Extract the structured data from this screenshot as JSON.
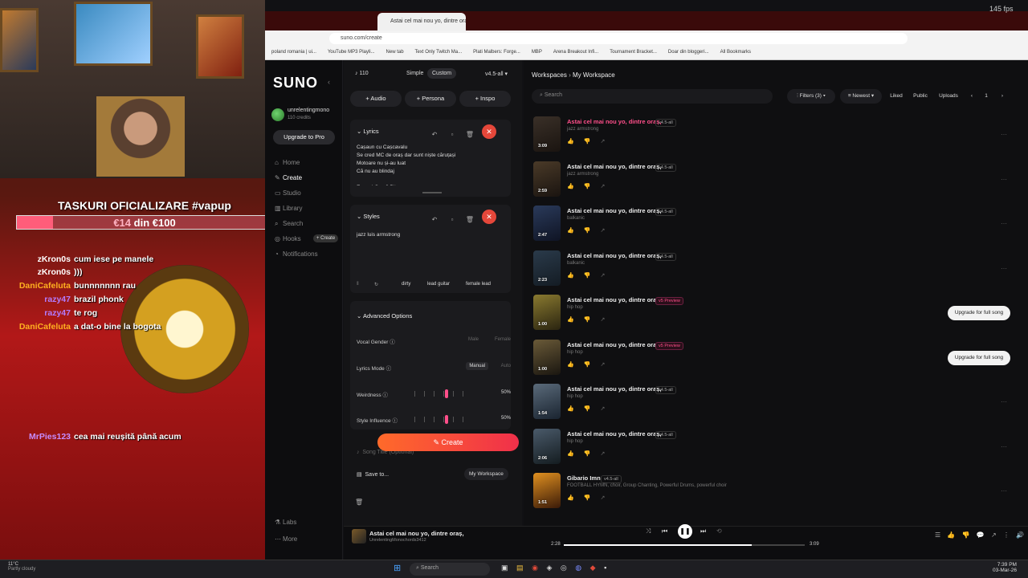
{
  "stream": {
    "task_title": "TASKURI OFICIALIZARE #vapup",
    "goal_current": "€14",
    "goal_text": " din €100",
    "goal_fraction": 0.14,
    "chat": [
      {
        "user": "zKron0s",
        "message": "cum iese pe manele",
        "color": "#ffffff"
      },
      {
        "user": "zKron0s",
        "message": ")))",
        "color": "#ffffff"
      },
      {
        "user": "DaniCafeluta",
        "message": "bunnnnnnn rau",
        "color": "#ffb020"
      },
      {
        "user": "razy47",
        "message": "brazil phonk",
        "color": "#b37cff"
      },
      {
        "user": "razy47",
        "message": "te rog",
        "color": "#b37cff"
      },
      {
        "user": "DaniCafeluta",
        "message": "a dat-o bine la bogota",
        "color": "#ffb020"
      },
      {
        "user": "MrPies123",
        "message": "cea mai reușită până acum",
        "color": "#c68cff"
      }
    ]
  },
  "fps": "145 fps",
  "browser": {
    "tab_title": "Astai cel mai nou yo, dintre oraș",
    "url": "suno.com/create",
    "bookmarks": [
      "poland romania | ui...",
      "YouTube MP3 Playli...",
      "New tab",
      "Text Only Twitch Ma...",
      "Plati Malbers: Forge...",
      "MBP",
      "Arena Breakout Infi...",
      "Tournament Bracket...",
      "Doar din bloggeri...",
      "All Bookmarks"
    ]
  },
  "nav": {
    "logo": "SUNO",
    "user_name": "unrelentingmono",
    "user_credits": "110 credits",
    "upgrade": "Upgrade to Pro",
    "items": [
      {
        "label": "Home",
        "icon": "⌂"
      },
      {
        "label": "Create",
        "icon": "✎"
      },
      {
        "label": "Studio",
        "icon": "▭"
      },
      {
        "label": "Library",
        "icon": "▥"
      },
      {
        "label": "Search",
        "icon": "⌕"
      },
      {
        "label": "Hooks",
        "icon": "◎"
      },
      {
        "label": "Notifications",
        "icon": "◔"
      }
    ],
    "hooks_badge": "+ Create",
    "bottom": [
      {
        "label": "Labs",
        "icon": "⚗"
      },
      {
        "label": "More",
        "icon": "⋯"
      }
    ]
  },
  "create": {
    "credits": "110",
    "mode_simple": "Simple",
    "mode_custom": "Custom",
    "model": "v4.5-all",
    "add_buttons": [
      "+ Audio",
      "+ Persona",
      "+ Inspo"
    ],
    "lyrics_title": "Lyrics",
    "lyrics_lines": [
      "Cașaun cu Cașcavalu",
      "Se cred MC de oraș dar sunt niște căruțași",
      "Motoare nu și-au luat",
      "Că nu au blindaj",
      "",
      "E ușor! Ceață Pitpaua"
    ],
    "styles_title": "Styles",
    "styles_text": "jazz luis armstrong",
    "style_tags": [
      "dirty",
      "lead guitar",
      "female lead"
    ],
    "advanced_title": "Advanced Options",
    "vocal_gender": {
      "label": "Vocal Gender",
      "opt1": "Male",
      "opt2": "Female"
    },
    "lyrics_mode": {
      "label": "Lyrics Mode",
      "opt1": "Manual",
      "opt2": "Auto"
    },
    "weirdness": {
      "label": "Weirdness",
      "value": "50%"
    },
    "style_influence": {
      "label": "Style Influence",
      "value": "50%"
    },
    "song_title_placeholder": "Song Title (Optional)",
    "save_to": "Save to...",
    "workspace": "My Workspace",
    "create_button": "Create"
  },
  "workspace": {
    "crumb_root": "Workspaces",
    "crumb_current": "My Workspace",
    "search_placeholder": "Search",
    "filters": "Filters (3)",
    "sort": "Newest",
    "liked": "Liked",
    "public": "Public",
    "uploads": "Uploads",
    "page": "1",
    "songs": [
      {
        "title": "Astai cel mai nou yo, dintre oraș,",
        "version": "v4.5-all",
        "style": "jazz armstrong",
        "duration": "3:09",
        "preview": false,
        "upgrade": false,
        "highlight": true,
        "colors": [
          "#3a3028",
          "#1a1410"
        ]
      },
      {
        "title": "Astai cel mai nou yo, dintre oraș,",
        "version": "v4.5-all",
        "style": "jazz armstrong",
        "duration": "2:59",
        "preview": false,
        "upgrade": false,
        "highlight": false,
        "colors": [
          "#4a3a28",
          "#1a1410"
        ]
      },
      {
        "title": "Astai cel mai nou yo, dintre oraș,",
        "version": "v4.5-all",
        "style": "balkanic",
        "duration": "2:47",
        "preview": false,
        "upgrade": false,
        "highlight": false,
        "colors": [
          "#2a3a5a",
          "#0f1424"
        ]
      },
      {
        "title": "Astai cel mai nou yo, dintre oraș,",
        "version": "v4.5-all",
        "style": "balkanic",
        "duration": "2:23",
        "preview": false,
        "upgrade": false,
        "highlight": false,
        "colors": [
          "#2a3a4a",
          "#141c24"
        ]
      },
      {
        "title": "Astai cel mai nou yo, dintre oraș,",
        "version": "v5 Preview",
        "style": "hip hop",
        "duration": "1:00",
        "preview": true,
        "upgrade": true,
        "highlight": false,
        "colors": [
          "#8a7a30",
          "#2a2410"
        ]
      },
      {
        "title": "Astai cel mai nou yo, dintre oraș,",
        "version": "v5 Preview",
        "style": "hip hop",
        "duration": "1:00",
        "preview": true,
        "upgrade": true,
        "highlight": false,
        "colors": [
          "#6a5a38",
          "#1a1610"
        ]
      },
      {
        "title": "Astai cel mai nou yo, dintre oraș,",
        "version": "v4.5-all",
        "style": "hip hop",
        "duration": "1:54",
        "preview": false,
        "upgrade": false,
        "highlight": false,
        "colors": [
          "#5a6a7a",
          "#1a2430"
        ]
      },
      {
        "title": "Astai cel mai nou yo, dintre oraș,",
        "version": "v4.5-all",
        "style": "hip hop",
        "duration": "2:06",
        "preview": false,
        "upgrade": false,
        "highlight": false,
        "colors": [
          "#4a5a6a",
          "#141c20"
        ]
      },
      {
        "title": "Gibario Imn",
        "version": "v4.5-all",
        "style": "FOOTBALL HYMN, choir, Group Chanting, Powerful Drums, powerful choir",
        "duration": "1:51",
        "preview": false,
        "upgrade": false,
        "highlight": false,
        "colors": [
          "#e09020",
          "#3a1a08"
        ]
      }
    ],
    "upgrade_label": "Upgrade for full song"
  },
  "player": {
    "title": "Astai cel mai nou yo, dintre oraș,",
    "artist": "UnrelentingMonochords3412",
    "elapsed": "2:28",
    "total": "3:09",
    "progress": 0.78
  },
  "taskbar": {
    "weather_temp": "11°C",
    "weather_desc": "Partly cloudy",
    "search": "Search",
    "time": "7:39 PM",
    "date": "03-Mar-26"
  }
}
